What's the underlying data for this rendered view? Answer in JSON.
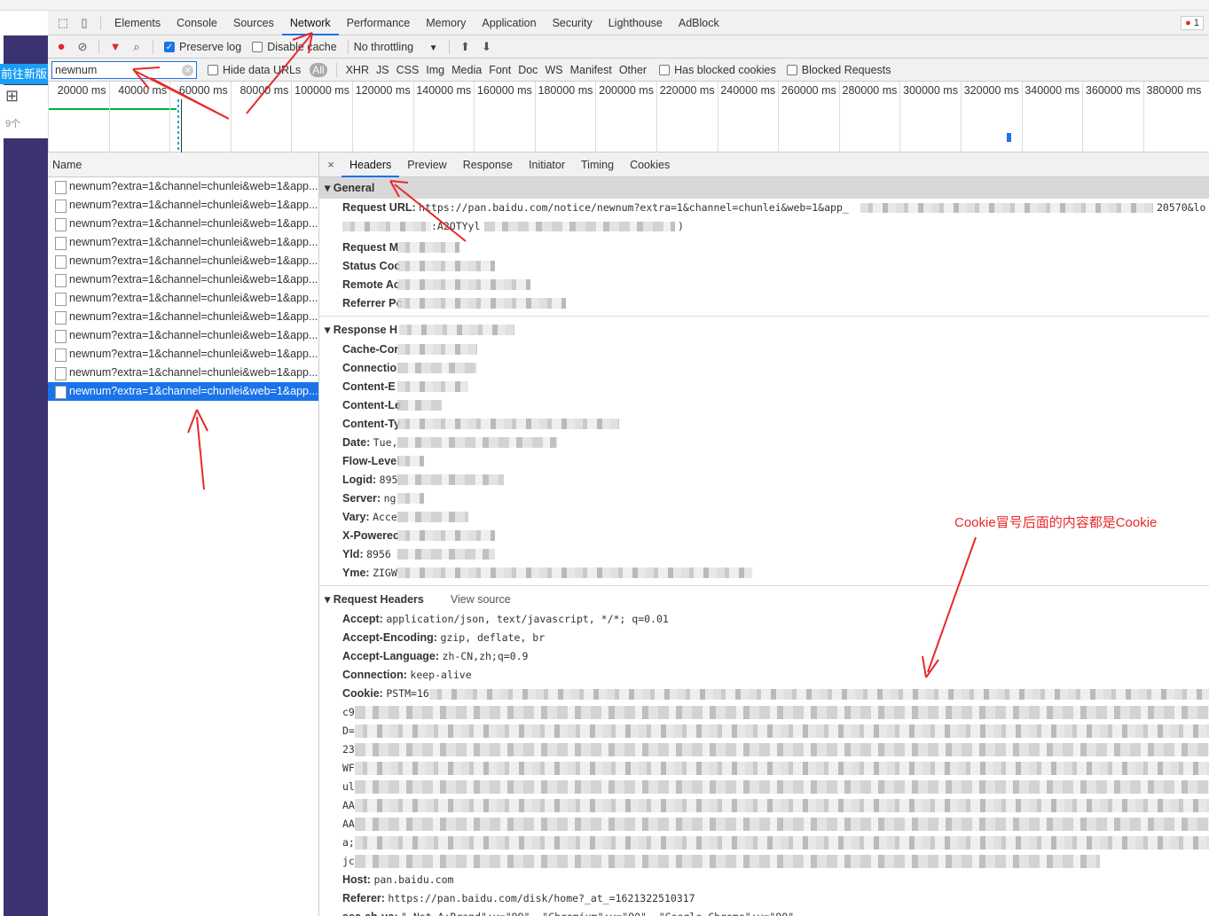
{
  "page": {
    "new_version_button": "前往新版",
    "count_fragment": "9个"
  },
  "devtools": {
    "tabs": [
      "Elements",
      "Console",
      "Sources",
      "Network",
      "Performance",
      "Memory",
      "Application",
      "Security",
      "Lighthouse",
      "AdBlock"
    ],
    "active_tab": "Network",
    "error_count": "1",
    "toolbar": {
      "preserve_log": "Preserve log",
      "preserve_log_checked": true,
      "disable_cache": "Disable cache",
      "disable_cache_checked": false,
      "throttling": "No throttling"
    },
    "filter": {
      "value": "newnum",
      "hide_data_urls": "Hide data URLs",
      "types": [
        "All",
        "XHR",
        "JS",
        "CSS",
        "Img",
        "Media",
        "Font",
        "Doc",
        "WS",
        "Manifest",
        "Other"
      ],
      "has_blocked_cookies": "Has blocked cookies",
      "blocked_requests": "Blocked Requests"
    },
    "timeline_ticks": [
      "20000 ms",
      "40000 ms",
      "60000 ms",
      "80000 ms",
      "100000 ms",
      "120000 ms",
      "140000 ms",
      "160000 ms",
      "180000 ms",
      "200000 ms",
      "220000 ms",
      "240000 ms",
      "260000 ms",
      "280000 ms",
      "300000 ms",
      "320000 ms",
      "340000 ms",
      "360000 ms",
      "380000 ms"
    ],
    "list": {
      "header": "Name",
      "rows": [
        "newnum?extra=1&channel=chunlei&web=1&app...",
        "newnum?extra=1&channel=chunlei&web=1&app...",
        "newnum?extra=1&channel=chunlei&web=1&app...",
        "newnum?extra=1&channel=chunlei&web=1&app...",
        "newnum?extra=1&channel=chunlei&web=1&app...",
        "newnum?extra=1&channel=chunlei&web=1&app...",
        "newnum?extra=1&channel=chunlei&web=1&app...",
        "newnum?extra=1&channel=chunlei&web=1&app...",
        "newnum?extra=1&channel=chunlei&web=1&app...",
        "newnum?extra=1&channel=chunlei&web=1&app...",
        "newnum?extra=1&channel=chunlei&web=1&app...",
        "newnum?extra=1&channel=chunlei&web=1&app..."
      ],
      "selected_index": 11
    },
    "detail": {
      "tabs": [
        "Headers",
        "Preview",
        "Response",
        "Initiator",
        "Timing",
        "Cookies"
      ],
      "active_tab": "Headers",
      "general": {
        "title": "General",
        "url_label": "Request URL:",
        "url_value": "https://pan.baidu.com/notice/newnum?extra=1&channel=chunlei&web=1&app_",
        "url_tail": "20570&lo",
        "url_line2": ":A2OTYyl",
        "url_line2_end": ")",
        "labels": [
          "Request M",
          "Status Coc",
          "Remote Ac",
          "Referrer Pc"
        ]
      },
      "response": {
        "title": "Response H",
        "rows": [
          [
            "Cache-Cor",
            ""
          ],
          [
            "Connectio",
            ""
          ],
          [
            "Content-E",
            ""
          ],
          [
            "Content-Le",
            ""
          ],
          [
            "Content-Ty",
            ""
          ],
          [
            "Date:",
            "Tue,"
          ],
          [
            "Flow-Level",
            ""
          ],
          [
            "Logid:",
            "895"
          ],
          [
            "Server:",
            "ng"
          ],
          [
            "Vary:",
            "Acce"
          ],
          [
            "X-Powerec",
            ""
          ],
          [
            "Yld:",
            "8956"
          ],
          [
            "Yme:",
            "ZIGW"
          ]
        ]
      },
      "request": {
        "title": "Request Headers",
        "view_source": "View source",
        "rows": [
          [
            "Accept:",
            "application/json, text/javascript, */*; q=0.01"
          ],
          [
            "Accept-Encoding:",
            "gzip, deflate, br"
          ],
          [
            "Accept-Language:",
            "zh-CN,zh;q=0.9"
          ],
          [
            "Connection:",
            "keep-alive"
          ]
        ],
        "cookie_label": "Cookie:",
        "cookie_start": "PSTM=16",
        "cookie_fragments": [
          "c9",
          "D=",
          "23",
          "WF",
          "ul",
          "AA",
          "AA",
          "a;",
          "jc"
        ],
        "tail": [
          [
            "Host:",
            "pan.baidu.com"
          ],
          [
            "Referer:",
            "https://pan.baidu.com/disk/home?_at_=1621322510317"
          ],
          [
            "sec-ch-ua:",
            "\" Not A;Brand\";v=\"99\", \"Chromium\";v=\"90\", \"Google Chrome\";v=\"90\""
          ]
        ]
      }
    }
  },
  "annotation": "Cookie冒号后面的内容都是Cookie",
  "colors": {
    "accent": "#1a73e8",
    "annotation": "#e8292b",
    "record": "#e0262b"
  }
}
